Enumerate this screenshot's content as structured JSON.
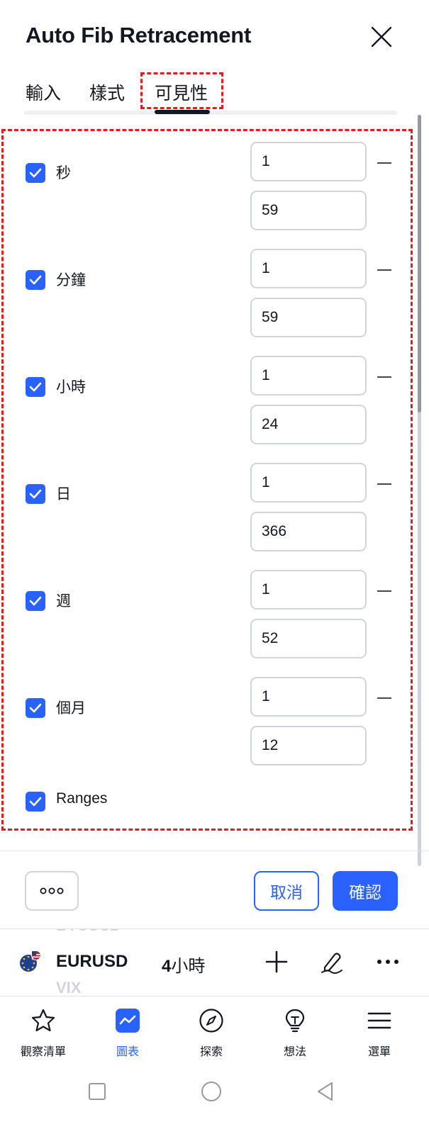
{
  "dialog": {
    "title": "Auto Fib Retracement",
    "tabs": [
      {
        "label": "輸入",
        "active": false
      },
      {
        "label": "樣式",
        "active": false
      },
      {
        "label": "可見性",
        "active": true
      }
    ]
  },
  "visibility": {
    "rows": [
      {
        "label": "秒",
        "checked": true,
        "from": "1",
        "to": "59"
      },
      {
        "label": "分鐘",
        "checked": true,
        "from": "1",
        "to": "59"
      },
      {
        "label": "小時",
        "checked": true,
        "from": "1",
        "to": "24"
      },
      {
        "label": "日",
        "checked": true,
        "from": "1",
        "to": "366"
      },
      {
        "label": "週",
        "checked": true,
        "from": "1",
        "to": "52"
      },
      {
        "label": "個月",
        "checked": true,
        "from": "1",
        "to": "12"
      }
    ],
    "ranges": {
      "label": "Ranges",
      "checked": true
    }
  },
  "footer": {
    "cancel_label": "取消",
    "ok_label": "確認"
  },
  "ticker": {
    "prev_symbol": "BTCUSD",
    "symbol": "EURUSD",
    "interval_number": "4",
    "interval_unit": "小時",
    "next_symbol": "VIX"
  },
  "bottom_nav": {
    "items": [
      {
        "label": "觀察清單",
        "active": false
      },
      {
        "label": "圖表",
        "active": true
      },
      {
        "label": "探索",
        "active": false
      },
      {
        "label": "想法",
        "active": false
      },
      {
        "label": "選單",
        "active": false
      }
    ]
  },
  "colors": {
    "accent": "#2962ff",
    "highlight": "#e11d1d",
    "text": "#131722",
    "border": "#d1d4dc"
  }
}
